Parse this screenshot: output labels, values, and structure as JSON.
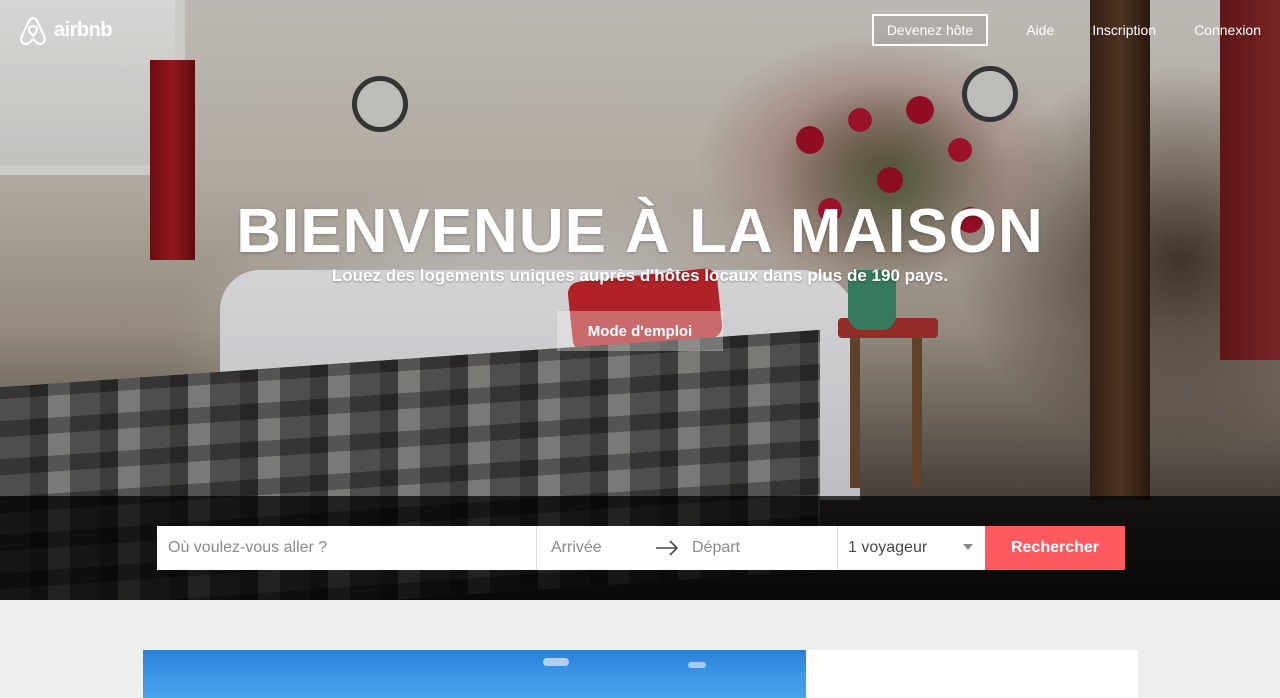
{
  "header": {
    "logo_text": "airbnb",
    "host_button": "Devenez hôte",
    "help_link": "Aide",
    "signup_link": "Inscription",
    "login_link": "Connexion"
  },
  "hero": {
    "title": "BIENVENUE À LA MAISON",
    "subtitle": "Louez des logements uniques auprès d'hôtes locaux dans plus de 190 pays.",
    "howto_button": "Mode d'emploi"
  },
  "search": {
    "where_placeholder": "Où voulez-vous aller ?",
    "checkin_placeholder": "Arrivée",
    "checkout_placeholder": "Départ",
    "guests_value": "1 voyageur",
    "submit_label": "Rechercher"
  },
  "colors": {
    "accent": "#ff5a5f",
    "below_fold_bg": "#edefed"
  },
  "icons": {
    "logo": "airbnb-belo-icon",
    "arrow": "arrow-right-icon",
    "caret": "caret-down-icon"
  }
}
